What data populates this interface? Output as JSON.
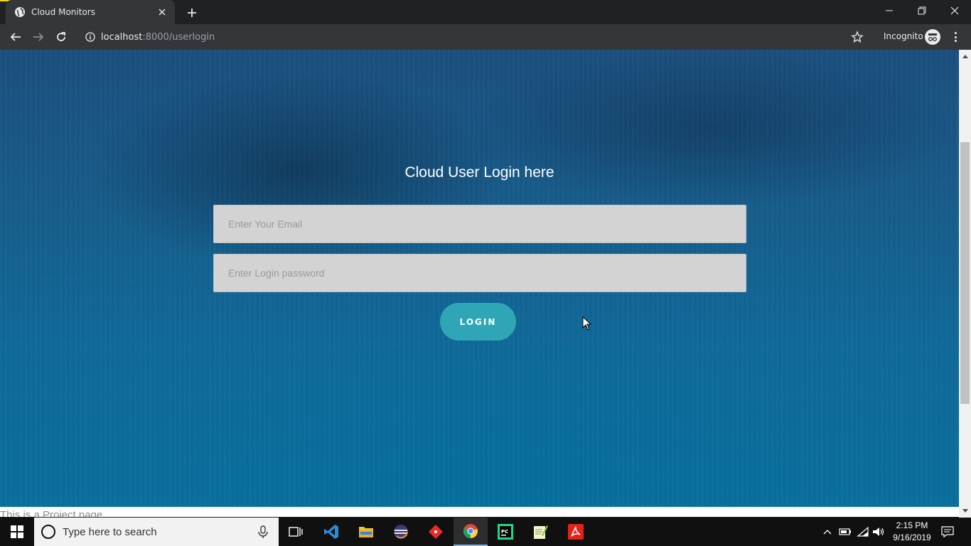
{
  "browser": {
    "tab_title": "Cloud Monitors",
    "url_host": "localhost",
    "url_rest": ":8000/userlogin",
    "incognito_label": "Incognito",
    "icons": [
      "globe-icon",
      "close-icon",
      "plus-icon",
      "back-icon",
      "forward-icon",
      "reload-icon",
      "info-icon",
      "star-icon",
      "incognito-icon",
      "menu-icon",
      "minimize-icon",
      "restore-icon",
      "window-close-icon"
    ]
  },
  "page": {
    "title": "Cloud User Login here",
    "email_placeholder": "Enter Your Email",
    "password_placeholder": "Enter Login password",
    "login_label": "LOGIN",
    "footer_text": "This is a Project page",
    "colors": {
      "background_top": "#1b4f7e",
      "background_bottom": "#0a6f9d",
      "field_bg": "#d3d3d3",
      "button_bg": "#2fa6b5"
    }
  },
  "taskbar": {
    "search_placeholder": "Type here to search",
    "apps": [
      "task-view-icon",
      "vscode-icon",
      "file-explorer-icon",
      "eclipse-icon",
      "git-icon",
      "chrome-icon",
      "pycharm-icon",
      "notepad-plus-icon",
      "acrobat-icon"
    ],
    "active_app": "chrome-icon",
    "time": "2:15 PM",
    "date": "9/16/2019"
  }
}
